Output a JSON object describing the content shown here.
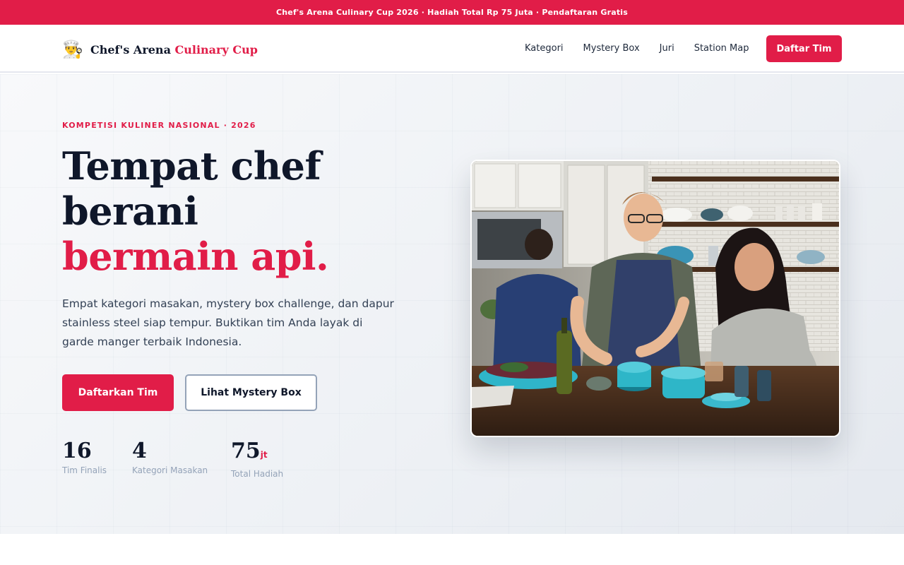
{
  "announcement": "Chef's Arena Culinary Cup 2026 · Hadiah Total Rp 75 Juta · Pendaftaran Gratis",
  "brand": {
    "logo_icon": "chef-emoji-icon",
    "logo_glyph": "👨‍🍳",
    "name": "Chef's Arena",
    "accent": "Culinary Cup"
  },
  "nav": {
    "links": [
      "Kategori",
      "Mystery Box",
      "Juri",
      "Station Map"
    ],
    "cta": "Daftar Tim"
  },
  "hero": {
    "eyebrow": "KOMPETISI KULINER NASIONAL · 2026",
    "headline": {
      "line1": "Tempat chef",
      "line2": "berani",
      "line3": "bermain api."
    },
    "lead": "Empat kategori masakan, mystery box challenge, dan dapur stainless steel siap tempur. Buktikan tim Anda layak di garde manger terbaik Indonesia.",
    "primary_button": "Daftarkan Tim",
    "secondary_button": "Lihat Mystery Box",
    "stats": [
      {
        "value": "16",
        "suffix": "",
        "label": "Tim Finalis"
      },
      {
        "value": "4",
        "suffix": "",
        "label": "Kategori Masakan"
      },
      {
        "value": "75",
        "suffix": "jt",
        "label": "Total Hadiah"
      }
    ]
  },
  "colors": {
    "accent": "#e11d48",
    "ink": "#0f172a",
    "muted": "#94a3b8",
    "body_text": "#334155"
  }
}
